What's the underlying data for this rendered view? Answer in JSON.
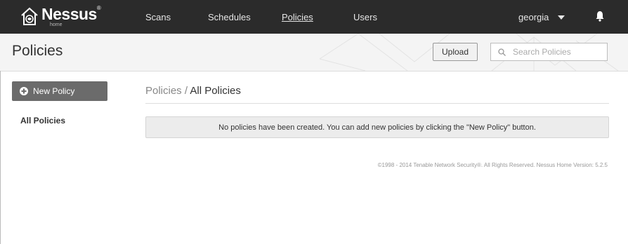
{
  "brand": {
    "name": "Nessus",
    "reg": "®",
    "sub": "home"
  },
  "nav": {
    "items": [
      {
        "label": "Scans",
        "active": false
      },
      {
        "label": "Schedules",
        "active": false
      },
      {
        "label": "Policies",
        "active": true
      },
      {
        "label": "Users",
        "active": false
      }
    ],
    "username": "georgia",
    "icons": {
      "user_menu": "chevron-down-icon",
      "notifications": "bell-icon"
    }
  },
  "header": {
    "title": "Policies",
    "upload_label": "Upload",
    "search_placeholder": "Search Policies"
  },
  "sidebar": {
    "new_button_label": "New Policy",
    "items": [
      {
        "label": "All Policies"
      }
    ]
  },
  "main": {
    "breadcrumb_root": "Policies",
    "breadcrumb_separator": "/",
    "breadcrumb_current": "All Policies",
    "empty_message": "No policies have been created. You can add new policies by clicking the \"New Policy\" button."
  },
  "footer": {
    "text": "©1998 - 2014 Tenable Network Security®. All Rights Reserved. Nessus Home Version: 5.2.5"
  },
  "colors": {
    "topbar": "#2b2b2b",
    "header_bg": "#f4f4f4",
    "primary_button": "#6b6b6b",
    "notice_bg": "#ececec"
  }
}
